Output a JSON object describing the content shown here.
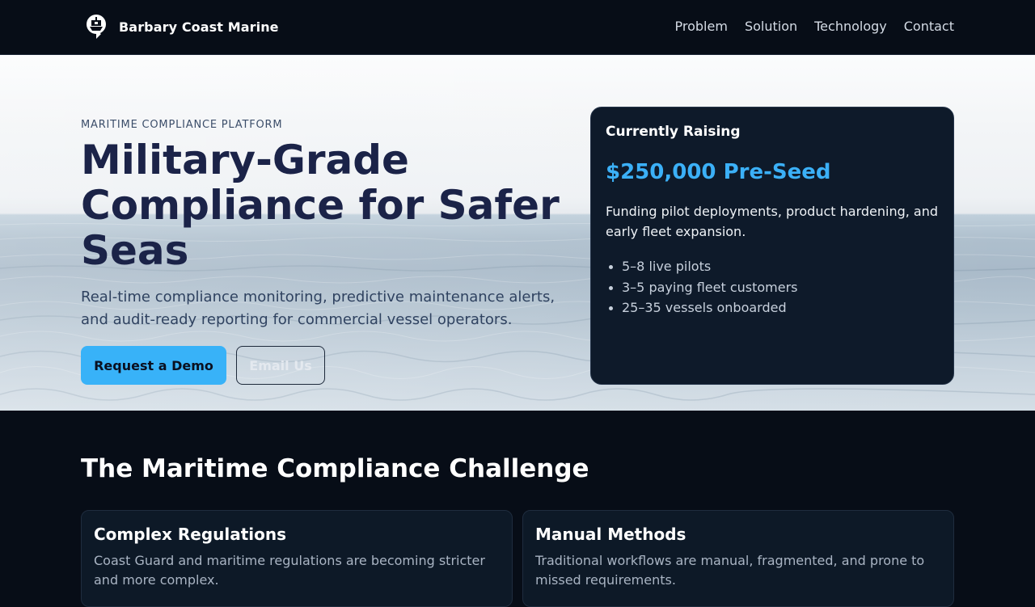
{
  "nav": {
    "brand_name": "Barbary Coast Marine",
    "links": [
      {
        "label": "Problem"
      },
      {
        "label": "Solution"
      },
      {
        "label": "Technology"
      },
      {
        "label": "Contact"
      }
    ]
  },
  "hero": {
    "eyebrow": "MARITIME COMPLIANCE PLATFORM",
    "title": "Military-Grade Compliance for Safer Seas",
    "subtitle": "Real-time compliance monitoring, predictive maintenance alerts, and audit-ready reporting for commercial vessel operators.",
    "primary_button": "Request a Demo",
    "secondary_button": "Email Us"
  },
  "raise_card": {
    "heading": "Currently Raising",
    "amount": "$250,000 Pre-Seed",
    "description": "Funding pilot deployments, product hardening, and early fleet expansion.",
    "items": [
      "5–8 live pilots",
      "3–5 paying fleet customers",
      "25–35 vessels onboarded"
    ]
  },
  "challenge": {
    "title": "The Maritime Compliance Challenge",
    "cards": [
      {
        "title": "Complex Regulations",
        "text": "Coast Guard and maritime regulations are becoming stricter and more complex."
      },
      {
        "title": "Manual Methods",
        "text": "Traditional workflows are manual, fragmented, and prone to missed requirements."
      }
    ]
  },
  "colors": {
    "accent": "#38b2f8",
    "background": "#070d17",
    "hero_title": "#1b2348",
    "card_bg": "#0e1a2a"
  },
  "icons": {
    "brand": "ship-helm-logo-icon"
  }
}
